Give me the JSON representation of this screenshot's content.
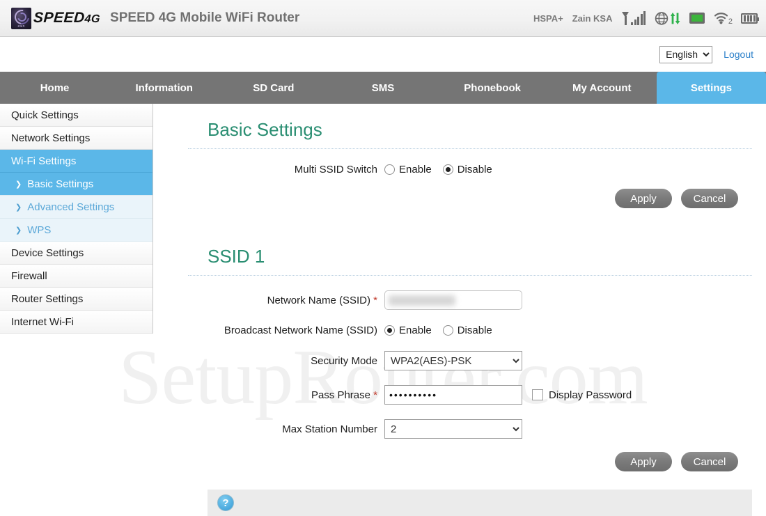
{
  "header": {
    "logo_text": "SPEED4G",
    "logo_badge_label": "zain",
    "title": "SPEED 4G Mobile WiFi Router",
    "status": {
      "network_type": "HSPA+",
      "carrier": "Zain KSA",
      "signal_icon": "signal-bars-icon",
      "globe_icon": "globe-data-transfer-icon",
      "sdcard_icon": "sd-card-icon",
      "wifi_icon": "wifi-icon",
      "wifi_client_count": "2",
      "battery_icon": "battery-icon"
    }
  },
  "utility": {
    "language_selected": "English",
    "language_options": [
      "English"
    ],
    "logout_label": "Logout"
  },
  "nav": {
    "items": [
      {
        "label": "Home",
        "active": false
      },
      {
        "label": "Information",
        "active": false
      },
      {
        "label": "SD Card",
        "active": false
      },
      {
        "label": "SMS",
        "active": false
      },
      {
        "label": "Phonebook",
        "active": false
      },
      {
        "label": "My Account",
        "active": false
      },
      {
        "label": "Settings",
        "active": true
      }
    ]
  },
  "sidebar": {
    "items": [
      {
        "label": "Quick Settings",
        "level": "top",
        "active": false
      },
      {
        "label": "Network Settings",
        "level": "top",
        "active": false
      },
      {
        "label": "Wi-Fi Settings",
        "level": "top",
        "active": true
      },
      {
        "label": "Basic Settings",
        "level": "sub",
        "active": true
      },
      {
        "label": "Advanced Settings",
        "level": "sub",
        "active": false
      },
      {
        "label": "WPS",
        "level": "sub",
        "active": false
      },
      {
        "label": "Device Settings",
        "level": "top",
        "active": false
      },
      {
        "label": "Firewall",
        "level": "top",
        "active": false
      },
      {
        "label": "Router Settings",
        "level": "top",
        "active": false
      },
      {
        "label": "Internet Wi-Fi",
        "level": "top",
        "active": false
      }
    ]
  },
  "basic_settings": {
    "heading": "Basic Settings",
    "multi_ssid": {
      "label": "Multi SSID Switch",
      "enable_label": "Enable",
      "disable_label": "Disable",
      "selected": "Disable"
    },
    "apply_label": "Apply",
    "cancel_label": "Cancel"
  },
  "ssid1": {
    "heading": "SSID 1",
    "network_name": {
      "label": "Network Name (SSID)",
      "required": "*",
      "value": "",
      "redacted": true
    },
    "broadcast": {
      "label": "Broadcast Network Name (SSID)",
      "enable_label": "Enable",
      "disable_label": "Disable",
      "selected": "Enable"
    },
    "security_mode": {
      "label": "Security Mode",
      "value": "WPA2(AES)-PSK",
      "options": [
        "WPA2(AES)-PSK"
      ]
    },
    "pass_phrase": {
      "label": "Pass Phrase",
      "required": "*",
      "value": "••••••••••",
      "display_password_label": "Display Password",
      "display_password_checked": false
    },
    "max_station": {
      "label": "Max Station Number",
      "value": "2",
      "options": [
        "2"
      ]
    },
    "apply_label": "Apply",
    "cancel_label": "Cancel"
  },
  "footer": {
    "help_icon_label": "?"
  },
  "watermark": {
    "text": "SetupRouter.com"
  },
  "colors": {
    "accent_blue": "#5bb7e8",
    "heading_green": "#2a8e72",
    "nav_gray": "#757575",
    "link_blue": "#2a7fc9",
    "required_red": "#c0392b",
    "status_green": "#3cb53c"
  }
}
